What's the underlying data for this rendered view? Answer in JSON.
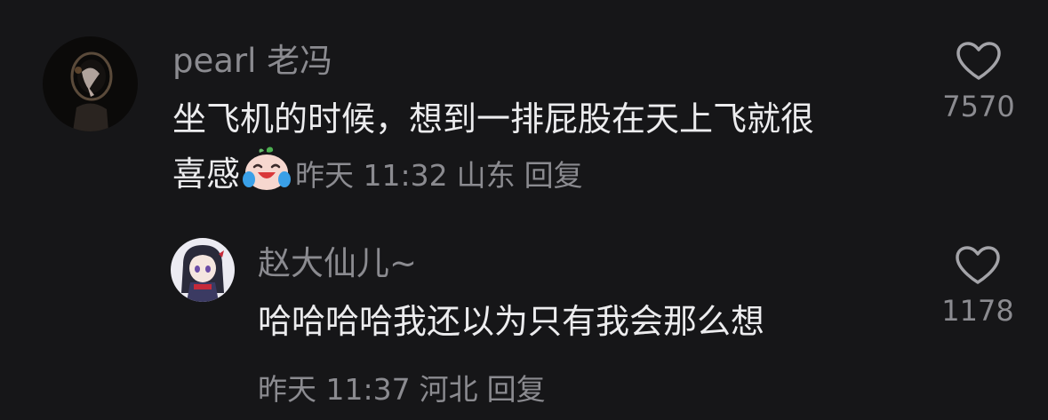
{
  "comments": [
    {
      "user": "pearl 老冯",
      "text_line1": "坐飞机的时候，想到一排屁股在天上飞就很",
      "text_line2": "喜感",
      "emoji": "crying-laughing-emoji",
      "time": "昨天 11:32",
      "location": "山东",
      "reply_label": "回复",
      "likes": "7570",
      "avatar_icon": "dark-portrait-avatar"
    }
  ],
  "replies": [
    {
      "user": "赵大仙儿~",
      "text": "哈哈哈哈我还以为只有我会那么想",
      "time": "昨天 11:37",
      "location": "河北",
      "reply_label": "回复",
      "likes": "1178",
      "avatar_icon": "anime-girl-avatar"
    }
  ],
  "colors": {
    "background": "#161618",
    "text_primary": "#ececee",
    "text_secondary": "#8b8b90"
  }
}
